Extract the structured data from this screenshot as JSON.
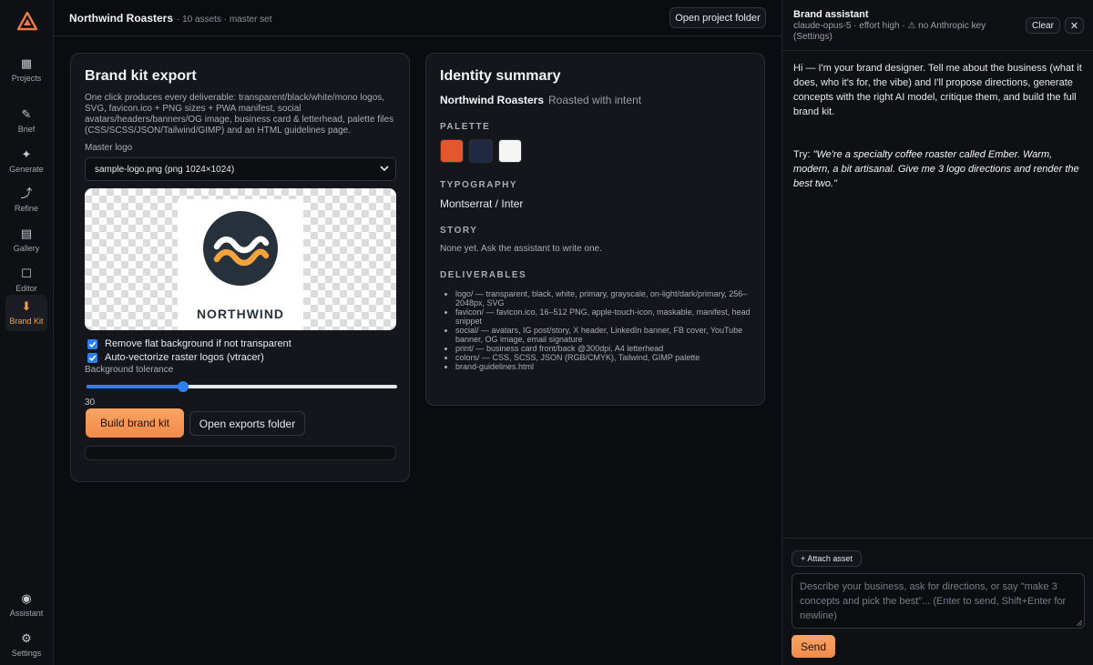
{
  "rail": {
    "items": [
      {
        "label": "Projects",
        "icon": "grid-icon"
      },
      {
        "label": "Brief",
        "icon": "pencil-icon"
      },
      {
        "label": "Generate",
        "icon": "sparkle-icon"
      },
      {
        "label": "Refine",
        "icon": "refine-arrow-icon"
      },
      {
        "label": "Gallery",
        "icon": "gallery-icon"
      },
      {
        "label": "Editor",
        "icon": "square-icon"
      },
      {
        "label": "Brand Kit",
        "icon": "download-icon"
      },
      {
        "label": "Assistant",
        "icon": "radio-icon"
      },
      {
        "label": "Settings",
        "icon": "gear-icon"
      }
    ],
    "active": "Brand Kit",
    "accent": "#f2a33c"
  },
  "topbar": {
    "project_name": "Northwind Roasters",
    "project_meta": "· 10 assets · master set",
    "open_project_folder": "Open project folder"
  },
  "export": {
    "title": "Brand kit export",
    "description": "One click produces every deliverable: transparent/black/white/mono logos, SVG, favicon.ico + PNG sizes + PWA manifest, social avatars/headers/banners/OG image, business card & letterhead, palette files (CSS/SCSS/JSON/Tailwind/GIMP) and an HTML guidelines page.",
    "master_logo_label": "Master logo",
    "master_logo_value": "sample-logo.png (png 1024×1024)",
    "logo_wordmark": "NORTHWIND",
    "remove_bg_label": "Remove flat background if not transparent",
    "remove_bg_checked": true,
    "vectorize_label": "Auto-vectorize raster logos (vtracer)",
    "vectorize_checked": true,
    "tolerance_label": "Background tolerance",
    "tolerance_value": "30",
    "tolerance_fraction": 0.31,
    "build_button": "Build brand kit",
    "open_exports_button": "Open exports folder"
  },
  "identity": {
    "title": "Identity summary",
    "brand_name": "Northwind Roasters",
    "tagline": "Roasted with intent",
    "palette_heading": "PALETTE",
    "palette": [
      "#e4572e",
      "#1f2942",
      "#f5f5f3"
    ],
    "typography_heading": "TYPOGRAPHY",
    "typography": "Montserrat / Inter",
    "story_heading": "STORY",
    "story": "None yet. Ask the assistant to write one.",
    "deliverables_heading": "DELIVERABLES",
    "deliverables": [
      "logo/ — transparent, black, white, primary, grayscale, on-light/dark/primary, 256–2048px, SVG",
      "favicon/ — favicon.ico, 16–512 PNG, apple-touch-icon, maskable, manifest, head snippet",
      "social/ — avatars, IG post/story, X header, LinkedIn banner, FB cover, YouTube banner, OG image, email signature",
      "print/ — business card front/back @300dpi, A4 letterhead",
      "colors/ — CSS, SCSS, JSON (RGB/CMYK), Tailwind, GIMP palette",
      "brand-guidelines.html"
    ]
  },
  "assistant": {
    "title": "Brand assistant",
    "subtitle": "claude-opus-5 · effort high · ⚠ no Anthropic key (Settings)",
    "clear_button": "Clear",
    "close_button": "✕",
    "message": "Hi — I'm your brand designer. Tell me about the business (what it does, who it's for, the vibe) and I'll propose directions, generate concepts with the right AI model, critique them, and build the full brand kit.",
    "try_prefix": "Try: ",
    "try_example": "\"We're a specialty coffee roaster called Ember. Warm, modern, a bit artisanal. Give me 3 logo directions and render the best two.\"",
    "attach_button": "+ Attach asset",
    "input_placeholder": "Describe your business, ask for directions, or say \"make 3 concepts and pick the best\"... (Enter to send, Shift+Enter for newline)",
    "send_button": "Send"
  }
}
